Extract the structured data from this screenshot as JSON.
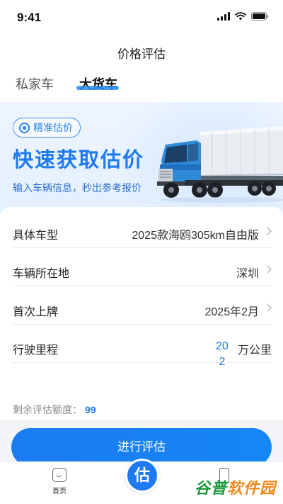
{
  "status_bar": {
    "time": "9:41"
  },
  "nav": {
    "title": "价格评估"
  },
  "tabs": [
    {
      "label": "私家车",
      "active": false
    },
    {
      "label": "大货车",
      "active": true
    }
  ],
  "banner": {
    "badge": "精准估价",
    "title": "快速获取估价",
    "subtitle": "输入车辆信息，秒出参考报价"
  },
  "form": {
    "model_label": "具体车型",
    "model_value": "2025款海鸥305km自由版",
    "location_label": "车辆所在地",
    "location_value": "深圳",
    "registration_label": "首次上牌",
    "registration_value": "2025年2月",
    "mileage_label": "行驶里程",
    "mileage_value": "202",
    "mileage_unit": "万公里"
  },
  "quota": {
    "label": "剩余评估额度：",
    "value": "99"
  },
  "submit_label": "进行评估",
  "bottom_nav": {
    "home_label": "首页",
    "center_label": "估"
  },
  "watermark": {
    "part1": "谷普",
    "part2": "软件园"
  },
  "colors": {
    "accent": "#1d7af0",
    "watermark": "#f08a1c"
  }
}
